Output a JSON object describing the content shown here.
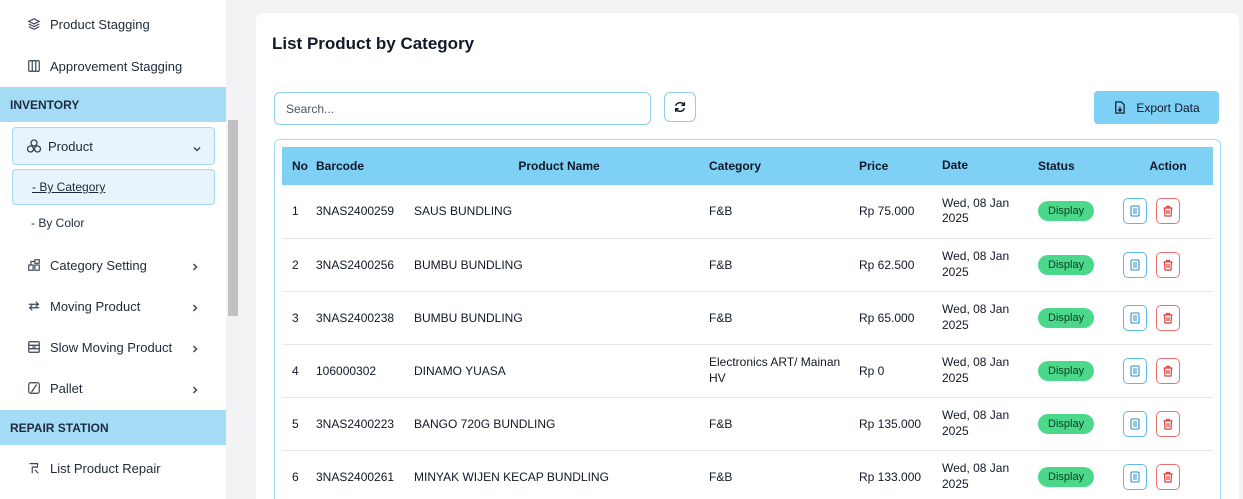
{
  "sidebar": {
    "product_stagging": "Product Stagging",
    "approvement_stagging": "Approvement Stagging",
    "inventory_section": "INVENTORY",
    "product": "Product",
    "by_category": "- By Category",
    "by_color": "- By Color",
    "category_setting": "Category Setting",
    "moving_product": "Moving Product",
    "slow_moving_product": "Slow Moving Product",
    "pallet": "Pallet",
    "repair_section": "REPAIR STATION",
    "list_product_repair": "List Product Repair"
  },
  "main": {
    "title": "List Product by Category",
    "search_placeholder": "Search...",
    "export_label": "Export Data",
    "columns": {
      "no": "No",
      "barcode": "Barcode",
      "product_name": "Product Name",
      "category": "Category",
      "price": "Price",
      "date": "Date",
      "status": "Status",
      "action": "Action"
    },
    "rows": [
      {
        "no": "1",
        "barcode": "3NAS2400259",
        "name": "SAUS BUNDLING",
        "category": "F&B",
        "price": "Rp 75.000",
        "date": "Wed, 08 Jan 2025",
        "status": "Display"
      },
      {
        "no": "2",
        "barcode": "3NAS2400256",
        "name": "BUMBU BUNDLING",
        "category": "F&B",
        "price": "Rp 62.500",
        "date": "Wed, 08 Jan 2025",
        "status": "Display"
      },
      {
        "no": "3",
        "barcode": "3NAS2400238",
        "name": "BUMBU BUNDLING",
        "category": "F&B",
        "price": "Rp 65.000",
        "date": "Wed, 08 Jan 2025",
        "status": "Display"
      },
      {
        "no": "4",
        "barcode": "106000302",
        "name": "DINAMO YUASA",
        "category": "Electronics ART/ Mainan HV",
        "price": "Rp 0",
        "date": "Wed, 08 Jan 2025",
        "status": "Display"
      },
      {
        "no": "5",
        "barcode": "3NAS2400223",
        "name": "BANGO 720G BUNDLING",
        "category": "F&B",
        "price": "Rp 135.000",
        "date": "Wed, 08 Jan 2025",
        "status": "Display"
      },
      {
        "no": "6",
        "barcode": "3NAS2400261",
        "name": "MINYAK WIJEN KECAP BUNDLING",
        "category": "F&B",
        "price": "Rp 133.000",
        "date": "Wed, 08 Jan 2025",
        "status": "Display"
      }
    ]
  },
  "colors": {
    "accent": "#7fd0f5",
    "section_bg": "#a5dcf5",
    "status_green": "#4cd88a",
    "delete_red": "#ef4444"
  },
  "icons": {
    "product_stagging": "layers-icon",
    "approvement_stagging": "columns-icon",
    "product": "boxes-icon",
    "category_setting": "grid-icon",
    "moving_product": "arrows-icon",
    "slow_moving_product": "archive-icon",
    "pallet": "pallet-icon",
    "list_product_repair": "repair-icon",
    "refresh": "refresh-icon",
    "export": "file-export-icon",
    "detail": "document-icon",
    "delete": "trash-icon"
  }
}
